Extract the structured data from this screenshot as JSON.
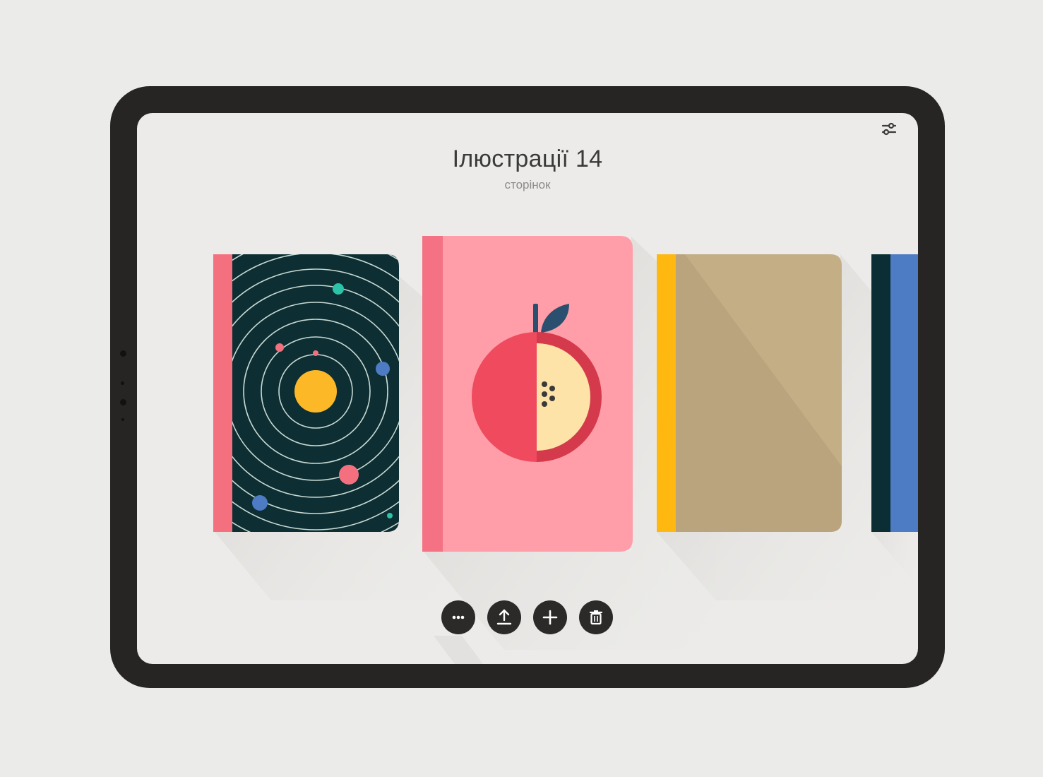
{
  "collection": {
    "title": "Ілюстрації 14",
    "subtitle": "сторінок"
  },
  "books": [
    {
      "id": "solar-system",
      "icon": "solar-system-illustration",
      "cover_color": "#0d2e33",
      "spine_color": "#f4707f"
    },
    {
      "id": "apple",
      "icon": "apple-illustration",
      "cover_color": "#ff9da8",
      "spine_color": "#f47283"
    },
    {
      "id": "plain-beige",
      "icon": "none",
      "cover_color": "#c3ae86",
      "spine_color": "#ffb80f"
    },
    {
      "id": "blue",
      "icon": "none",
      "cover_color": "#4d7bc4",
      "spine_color": "#0a2e33"
    }
  ],
  "toolbar": [
    {
      "id": "more",
      "icon": "more-dots-icon"
    },
    {
      "id": "share",
      "icon": "upload-icon"
    },
    {
      "id": "add",
      "icon": "plus-icon"
    },
    {
      "id": "delete",
      "icon": "trash-icon"
    }
  ],
  "header": {
    "icon": "settings-sliders-icon"
  }
}
